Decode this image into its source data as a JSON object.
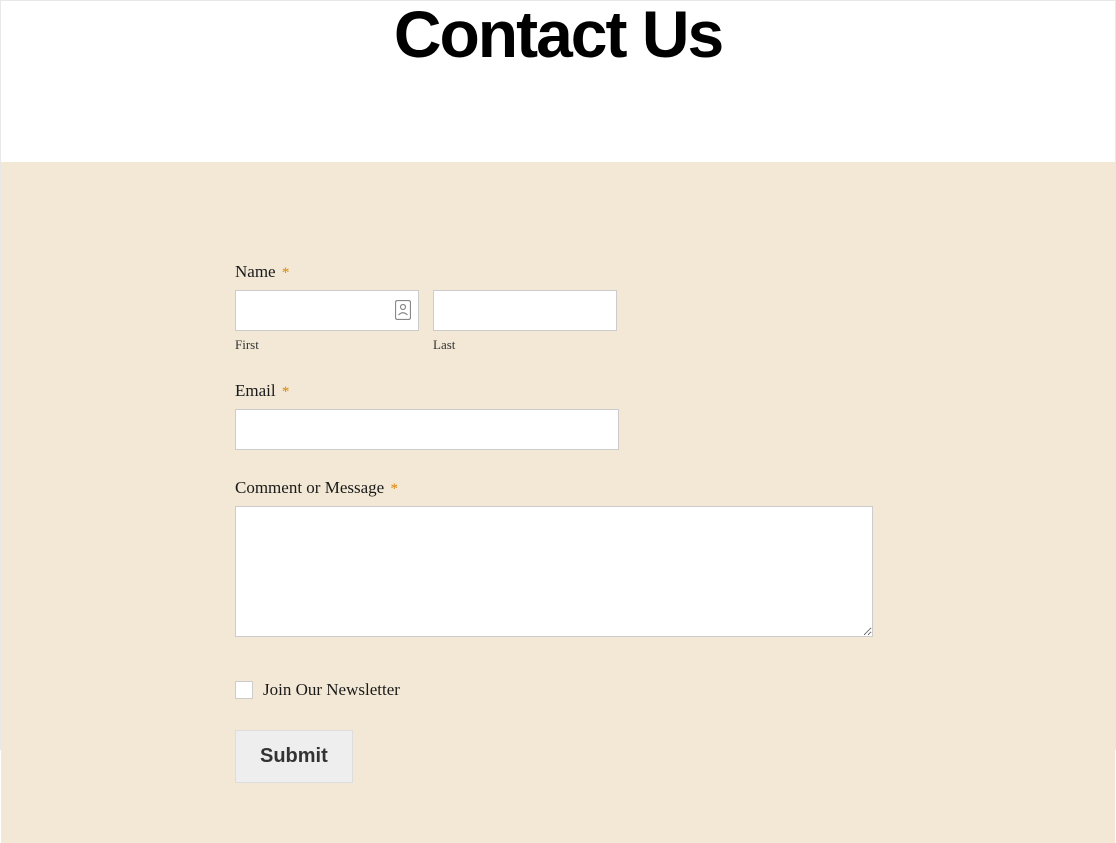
{
  "page": {
    "title": "Contact Us"
  },
  "form": {
    "name": {
      "label": "Name",
      "required": "*",
      "first_sublabel": "First",
      "last_sublabel": "Last"
    },
    "email": {
      "label": "Email",
      "required": "*"
    },
    "comment": {
      "label": "Comment or Message",
      "required": "*"
    },
    "newsletter": {
      "label": "Join Our Newsletter"
    },
    "submit": {
      "label": "Submit"
    }
  }
}
